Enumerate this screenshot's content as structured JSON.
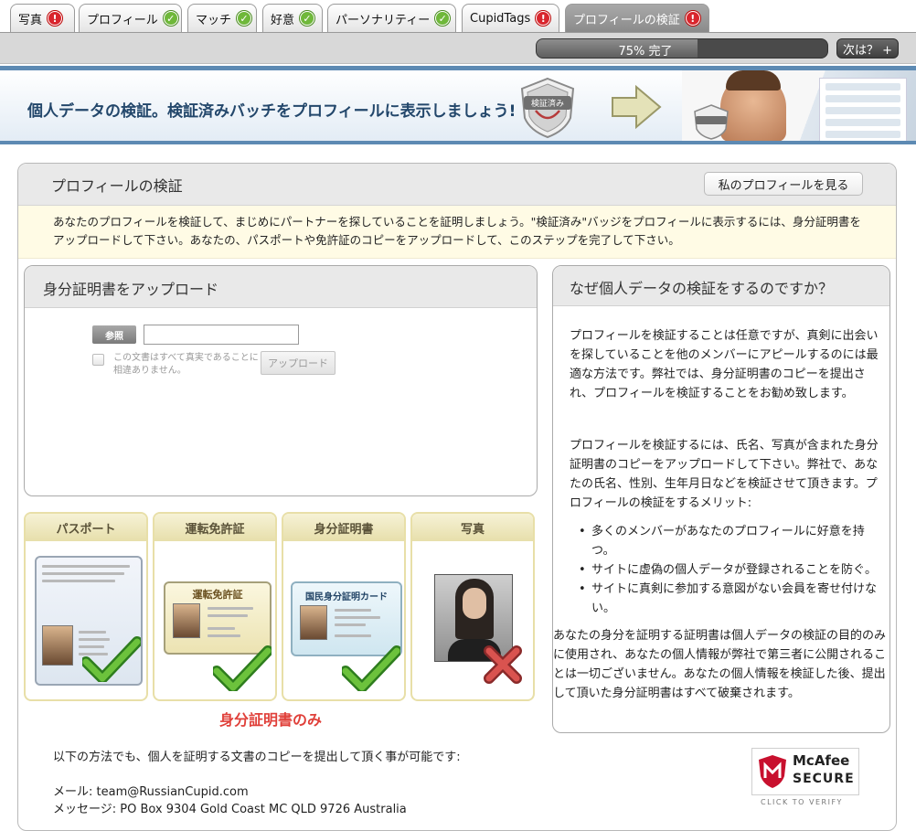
{
  "tabs": [
    {
      "label": "写真",
      "status": "error"
    },
    {
      "label": "プロフィール",
      "status": "ok"
    },
    {
      "label": "マッチ",
      "status": "ok"
    },
    {
      "label": "好意",
      "status": "ok"
    },
    {
      "label": "パーソナリティー",
      "status": "ok"
    },
    {
      "label": "CupidTags",
      "status": "error"
    },
    {
      "label": "プロフィールの検証",
      "status": "error",
      "active": true
    }
  ],
  "progress": {
    "percent": 75,
    "label": "75% 完了",
    "next_label": "次は？ +"
  },
  "banner": {
    "headline": "個人データの検証。検証済みバッチをプロフィールに表示しましょう!",
    "badge_text": "検証済み"
  },
  "panel": {
    "title": "プロフィールの検証",
    "view_profile_label": "私のプロフィールを見る",
    "intro": "あなたのプロフィールを検証して、まじめにパートナーを探していることを証明しましょう。\"検証済み\"バッジをプロフィールに表示するには、身分証明書をアップロードして下さい。あなたの、パスポートや免許証のコピーをアップロードして、このステップを完了して下さい。"
  },
  "upload": {
    "title": "身分証明書をアップロード",
    "browse_label": "参照",
    "file_value": "",
    "agree_text": "この文書はすべて真実であることに相違ありません。",
    "upload_label": "アップロード"
  },
  "doc_cards": [
    {
      "title": "パスポート",
      "accepted": true
    },
    {
      "title": "運転免許証",
      "accepted": true,
      "doc_label": "運転免許証"
    },
    {
      "title": "身分証明書",
      "accepted": true,
      "doc_label": "国民身分証明カード"
    },
    {
      "title": "写真",
      "accepted": false
    }
  ],
  "ids_only": "身分証明書のみ",
  "why": {
    "title": "なぜ個人データの検証をするのですか？",
    "p1": "プロフィールを検証することは任意ですが、真剣に出会いを探していることを他のメンバーにアピールするのには最適な方法です。弊社では、身分証明書のコピーを提出され、プロフィールを検証することをお勧め致します。",
    "p2": "プロフィールを検証するには、氏名、写真が含まれた身分証明書のコピーをアップロードして下さい。弊社で、あなたの氏名、性別、生年月日などを検証させて頂きます。プロフィールの検証をするメリット:",
    "benefits": [
      "多くのメンバーがあなたのプロフィールに好意を持つ。",
      "サイトに虚偽の個人データが登録されることを防ぐ。",
      "サイトに真剣に参加する意図がない会員を寄せ付けない。"
    ],
    "p3": "あなたの身分を証明する証明書は個人データの検証の目的のみに使用され、あなたの個人情報が弊社で第三者に公開されることは一切ございません。あなたの個人情報を検証した後、提出して頂いた身分証明書はすべて破棄されます。"
  },
  "contact": {
    "alt_methods": "以下の方法でも、個人を証明する文書のコピーを提出して頂く事が可能です:",
    "email": "メール: team@RussianCupid.com",
    "mail": "メッセージ: PO Box 9304 Gold Coast MC QLD 9726 Australia"
  },
  "mcafee": {
    "name": "McAfee",
    "secure": "SECURE",
    "click": "CLICK TO VERIFY"
  },
  "colors": {
    "error": "#d9262e",
    "ok": "#6fb83a",
    "banner_blue": "#5d8ab3",
    "ids_only_red": "#e0403a"
  }
}
